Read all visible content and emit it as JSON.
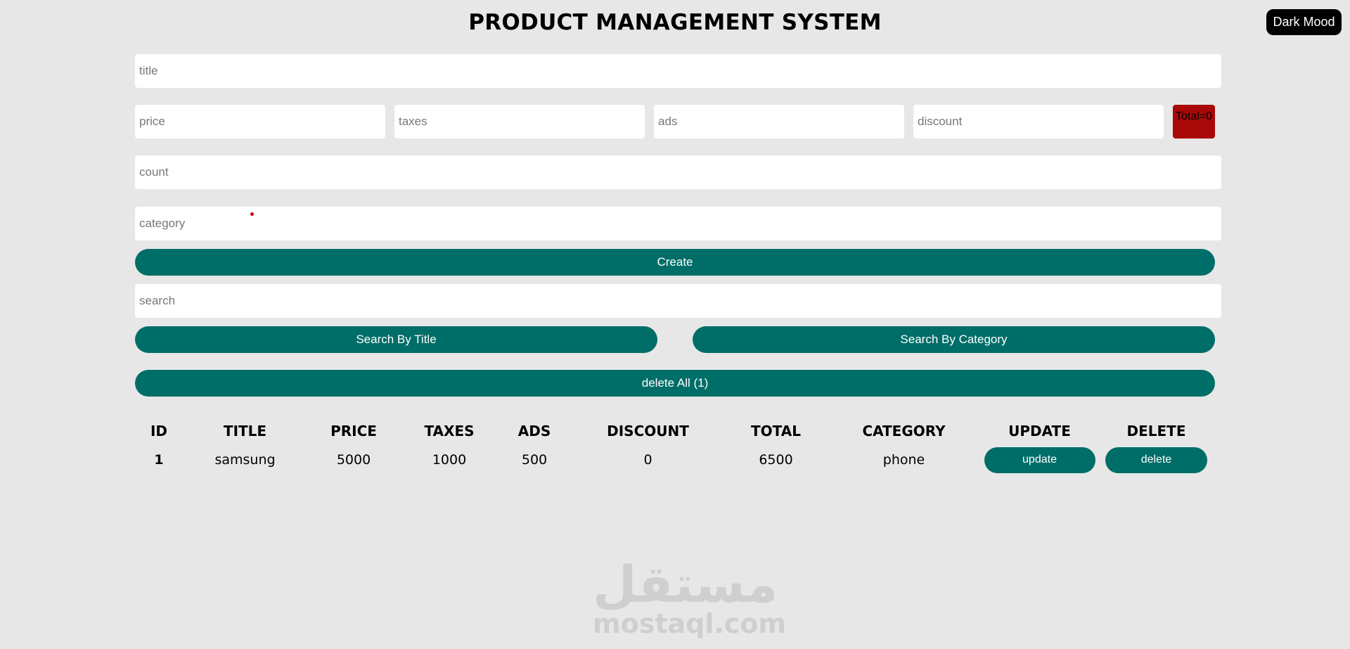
{
  "header": {
    "title": "PRODUCT MANAGEMENT SYSTEM",
    "dark_mode_label": "Dark Mood"
  },
  "form": {
    "title_placeholder": "title",
    "price_placeholder": "price",
    "taxes_placeholder": "taxes",
    "ads_placeholder": "ads",
    "discount_placeholder": "discount",
    "total_label": "Total=0",
    "count_placeholder": "count",
    "category_placeholder": "category",
    "create_label": "Create"
  },
  "search": {
    "placeholder": "search",
    "by_title_label": "Search By Title",
    "by_category_label": "Search By Category"
  },
  "delete_all_label": "delete All (1)",
  "table": {
    "headers": [
      "ID",
      "TITLE",
      "PRICE",
      "TAXES",
      "ADS",
      "DISCOUNT",
      "TOTAL",
      "CATEGORY",
      "UPDATE",
      "DELETE"
    ],
    "rows": [
      {
        "id": "1",
        "title": "samsung",
        "price": "5000",
        "taxes": "1000",
        "ads": "500",
        "discount": "0",
        "total": "6500",
        "category": "phone",
        "update_label": "update",
        "delete_label": "delete"
      }
    ]
  },
  "watermark": {
    "arabic": "مستقل",
    "latin": "mostaql.com"
  },
  "colors": {
    "background": "#e7e7e7",
    "accent": "#006e68",
    "total_box": "#a90808",
    "dark_button": "#000000"
  }
}
